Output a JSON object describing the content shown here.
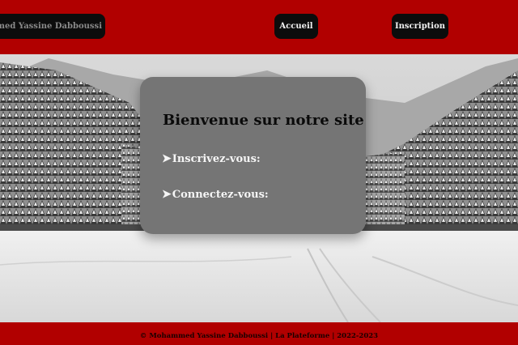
{
  "header": {
    "author_button": "ohammed Yassine Dabboussi",
    "nav": {
      "home_label": "Accueil",
      "signup_label": "Inscription"
    }
  },
  "welcome_card": {
    "title": "Bienvenue sur notre site",
    "links": [
      {
        "arrow": "➤",
        "label": "Inscrivez-vous:"
      },
      {
        "arrow": "➤",
        "label": "Connectez-vous:"
      }
    ]
  },
  "footer": {
    "text": "© Mohammed Yassine Dabboussi | La Plateforme | 2022-2023"
  },
  "colors": {
    "brand_red": "#b10000",
    "button_black": "#0c0c0c",
    "card_gray": "#757575"
  }
}
